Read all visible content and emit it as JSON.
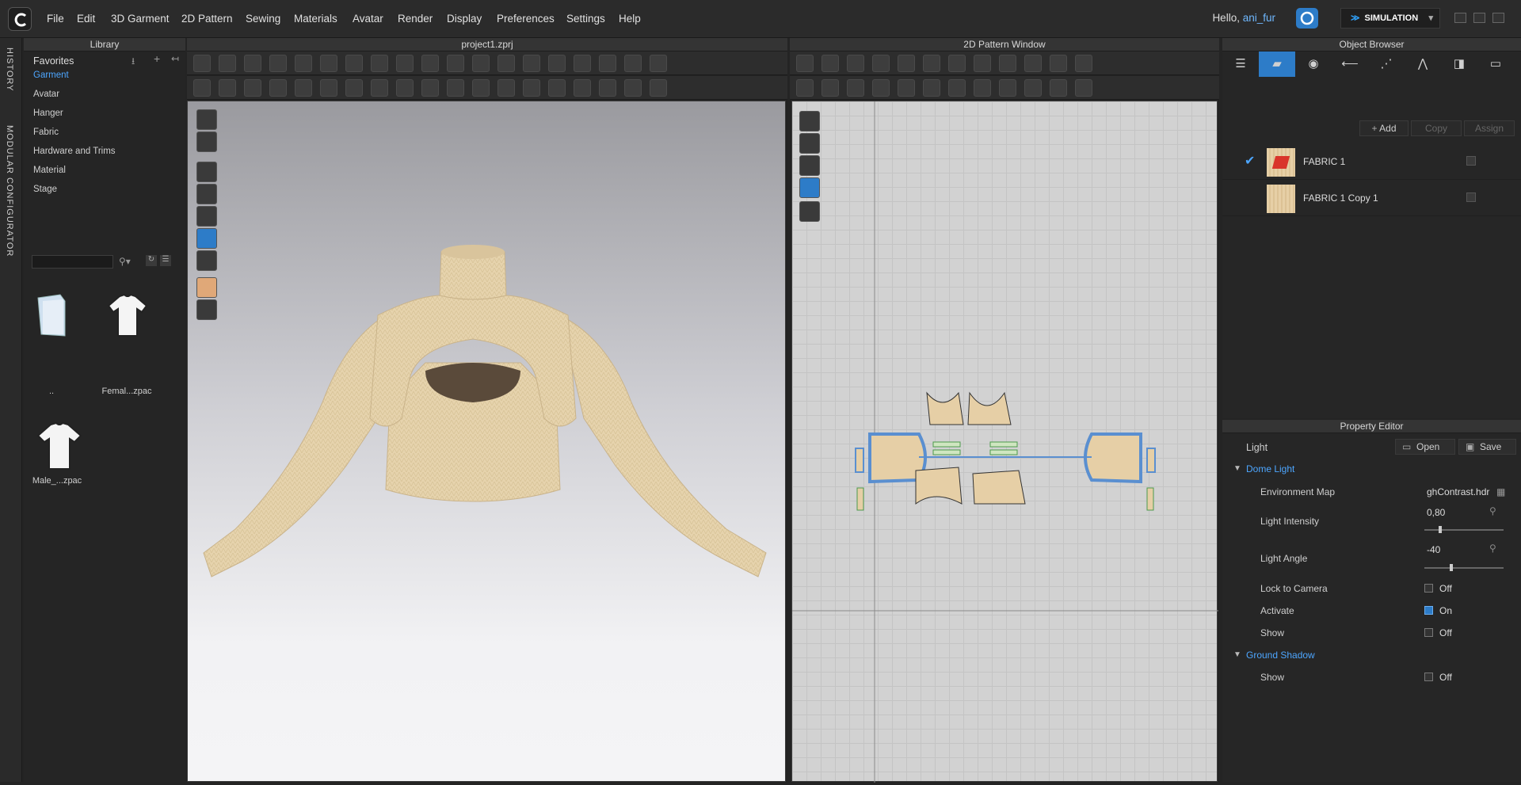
{
  "app": {
    "menu": [
      "File",
      "Edit",
      "3D Garment",
      "2D Pattern",
      "Sewing",
      "Materials",
      "Avatar",
      "Render",
      "Display",
      "Preferences",
      "Settings",
      "Help"
    ],
    "greeting": "Hello,",
    "username": "ani_fur",
    "mode": "SIMULATION"
  },
  "side_tabs": {
    "history": "HISTORY",
    "modular": "MODULAR CONFIGURATOR"
  },
  "library": {
    "title": "Library",
    "favorites": "Favorites",
    "items": [
      "Garment",
      "Avatar",
      "Hanger",
      "Fabric",
      "Hardware and Trims",
      "Material",
      "Stage"
    ],
    "files": [
      "..",
      "Femal...zpac",
      "Male_...zpac"
    ]
  },
  "viewport3d": {
    "title": "project1.zprj"
  },
  "pattern": {
    "title": "2D Pattern Window"
  },
  "object_browser": {
    "title": "Object Browser",
    "add": "Add",
    "copy": "Copy",
    "assign": "Assign",
    "fabrics": [
      "FABRIC 1",
      "FABRIC 1 Copy 1"
    ]
  },
  "property_editor": {
    "title": "Property Editor",
    "object": "Light",
    "open": "Open",
    "save": "Save",
    "dome_light": "Dome Light",
    "env_map_label": "Environment Map",
    "env_map_value": "ghContrast.hdr",
    "intensity_label": "Light Intensity",
    "intensity_value": "0,80",
    "intensity_fraction": 0.18,
    "angle_label": "Light Angle",
    "angle_value": "-40",
    "angle_fraction": 0.32,
    "lock_label": "Lock to Camera",
    "lock_value": "Off",
    "activate_label": "Activate",
    "activate_value": "On",
    "show_label": "Show",
    "show_value": "Off",
    "ground_shadow": "Ground Shadow",
    "gs_show_label": "Show",
    "gs_show_value": "Off"
  },
  "colors": {
    "accent": "#4da6ff",
    "fabric": "#e6cfa6",
    "pattern_outline": "#5a8fd0"
  }
}
